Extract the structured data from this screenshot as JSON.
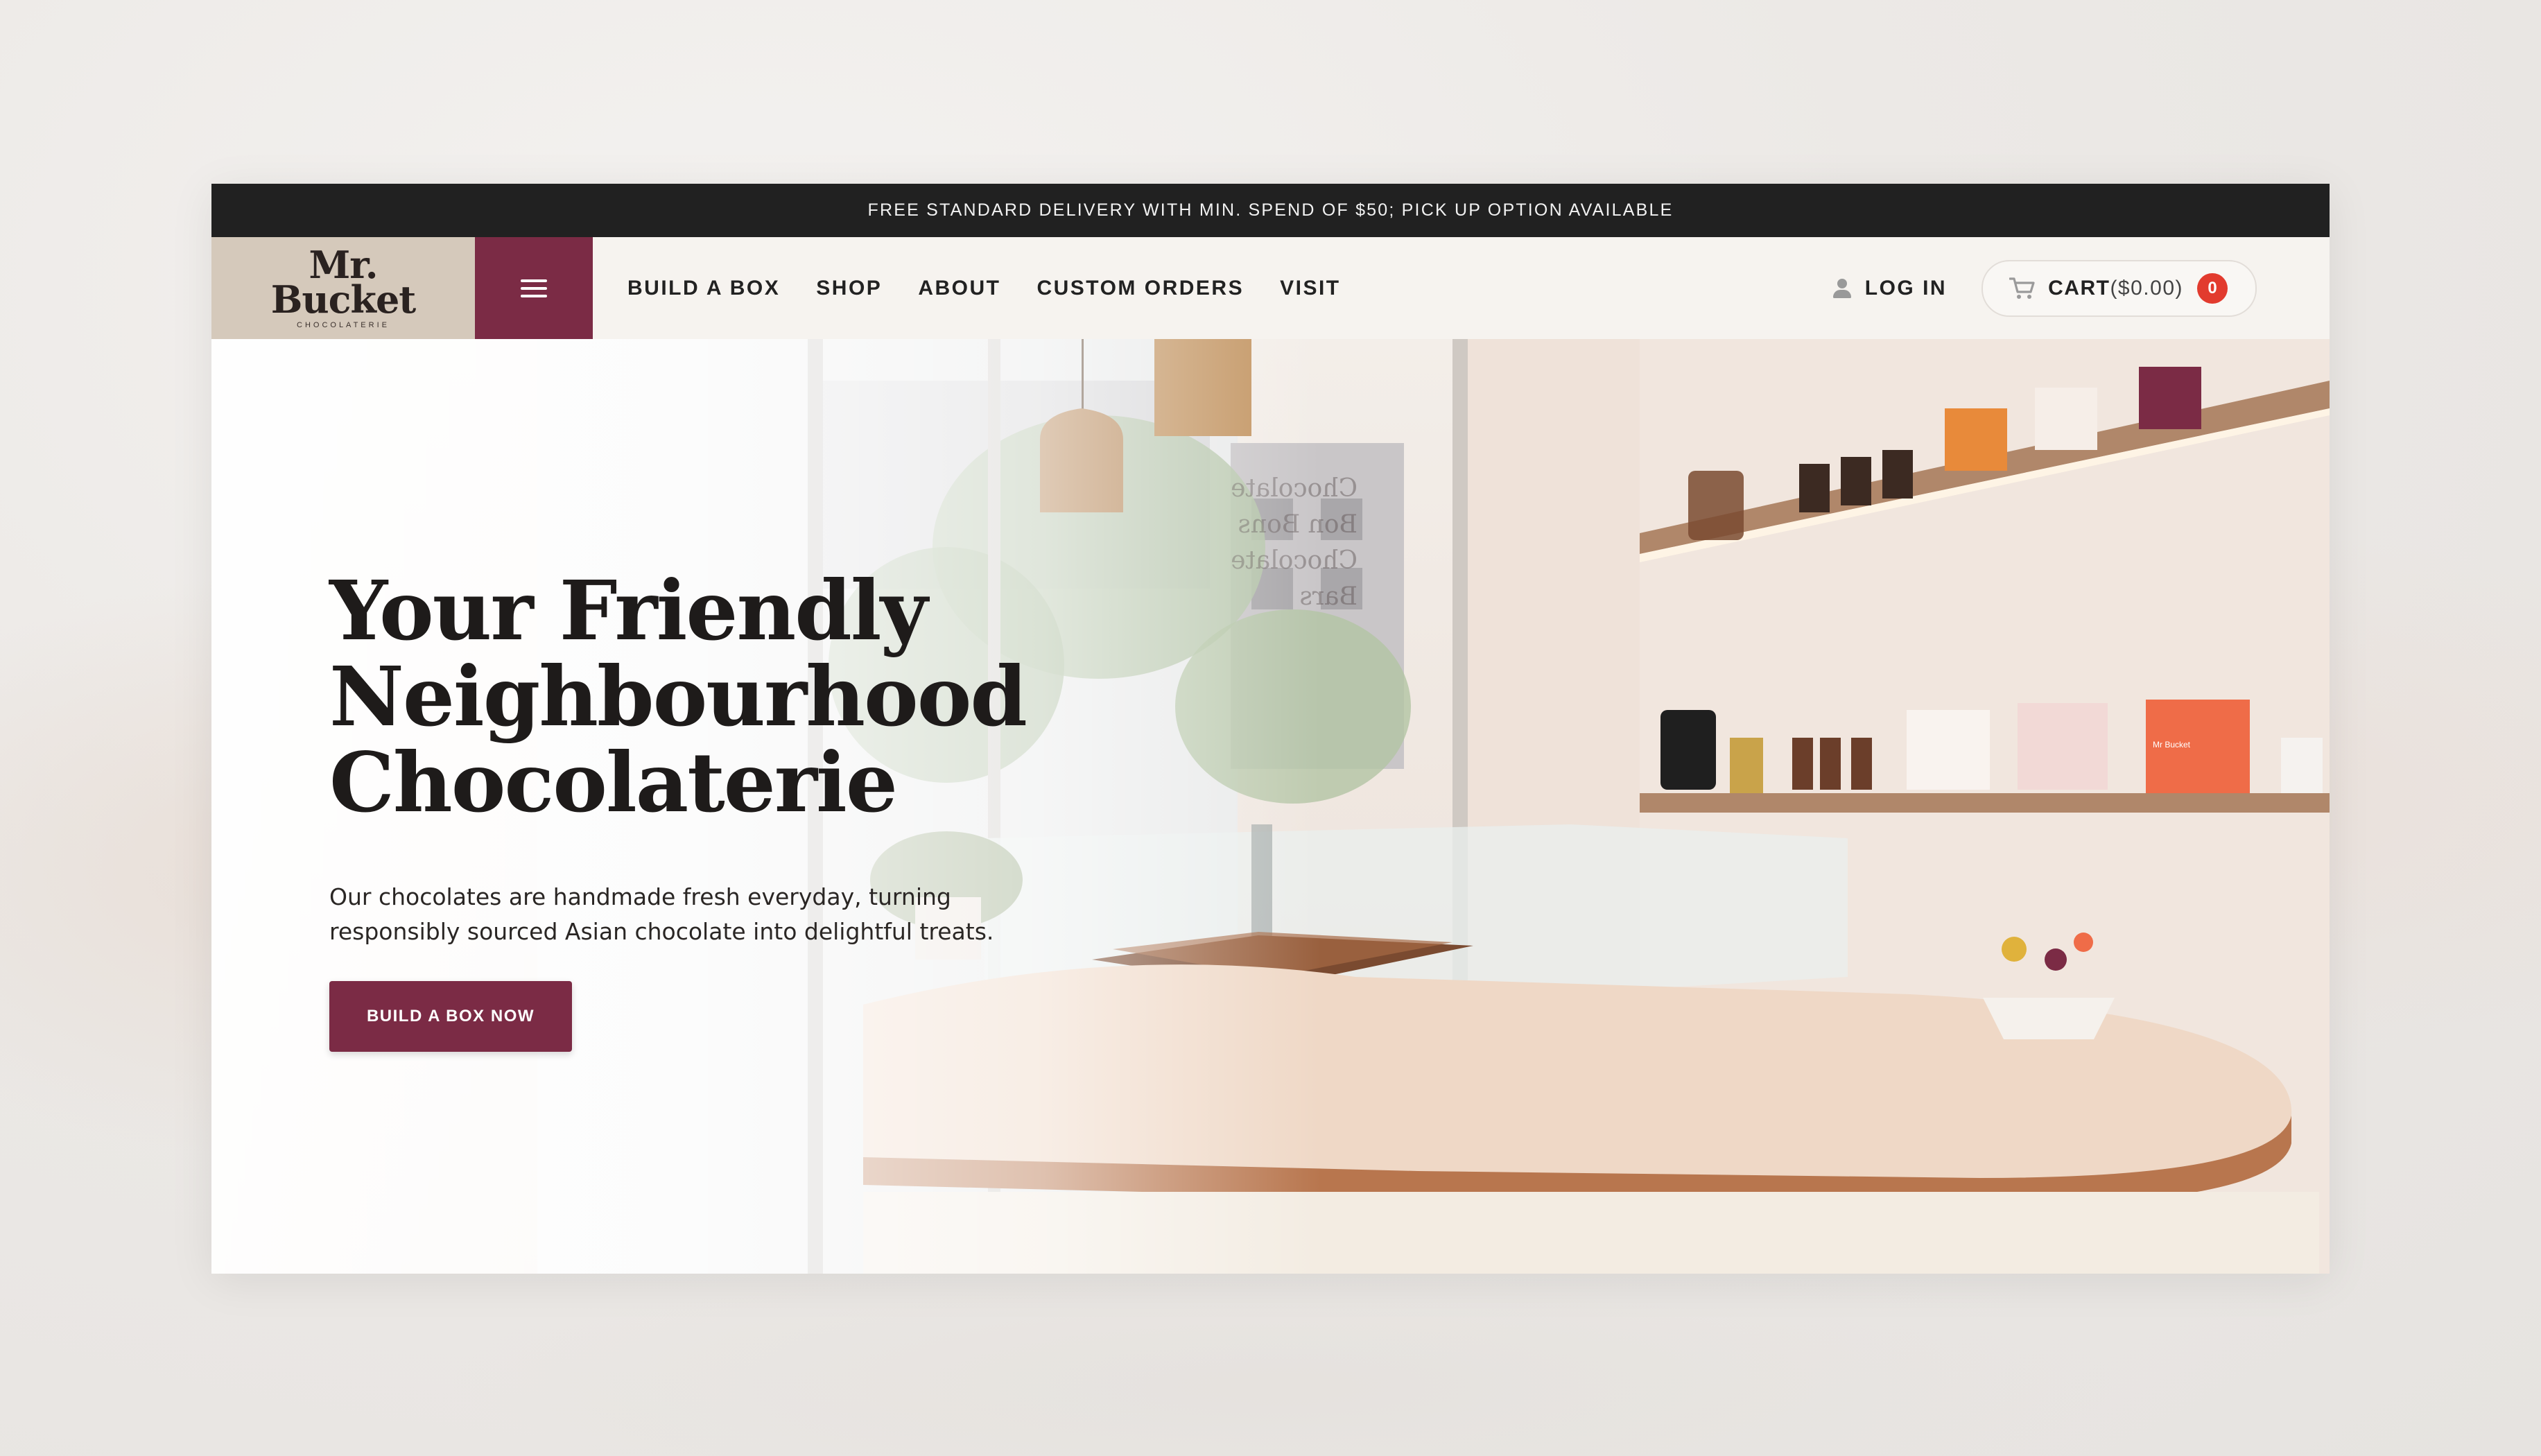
{
  "promo_bar": {
    "text": "FREE STANDARD DELIVERY WITH MIN. SPEND OF $50; PICK UP OPTION AVAILABLE"
  },
  "brand": {
    "name_line1": "Mr.",
    "name_line2": "Bucket",
    "tagline": "CHOCOLATERIE"
  },
  "nav": {
    "links": [
      {
        "label": "BUILD A BOX"
      },
      {
        "label": "SHOP"
      },
      {
        "label": "ABOUT"
      },
      {
        "label": "CUSTOM ORDERS"
      },
      {
        "label": "VISIT"
      }
    ],
    "login_label": "LOG IN",
    "cart_label": "CART",
    "cart_total": "($0.00)",
    "cart_count": "0"
  },
  "hero": {
    "title_line1": "Your Friendly",
    "title_line2": "Neighbourhood",
    "title_line3": "Chocolaterie",
    "description_line1": "Our chocolates are handmade fresh everyday, turning",
    "description_line2": "responsibly sourced Asian chocolate into delightful treats.",
    "cta_label": "BUILD A BOX NOW"
  },
  "shop_signage": {
    "window_text": [
      "Chocolate",
      "Bon Bons",
      "Chocolate",
      "Bars"
    ],
    "box_label": "Mr Bucket"
  },
  "colors": {
    "brand_plum": "#7b2b45",
    "logo_bg": "#d5c9bb",
    "promo_bg": "#212121",
    "nav_bg": "#f6f3ef",
    "badge_red": "#e23b2e",
    "copper": "#b8764e"
  },
  "icons": {
    "menu": "hamburger-icon",
    "login": "user-icon",
    "cart": "cart-icon"
  }
}
